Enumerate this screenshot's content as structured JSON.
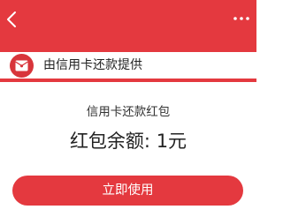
{
  "theme": {
    "accent": "#e4393f",
    "background": "#ffffff"
  },
  "nav": {
    "back_icon": "chevron-left-icon",
    "more_icon": "more-horizontal-icon"
  },
  "provider": {
    "icon": "red-envelope-icon",
    "text": "由信用卡还款提供"
  },
  "card": {
    "subtitle": "信用卡还款红包",
    "amount_text": "红包余额: 1元"
  },
  "action": {
    "use_label": "立即使用"
  }
}
